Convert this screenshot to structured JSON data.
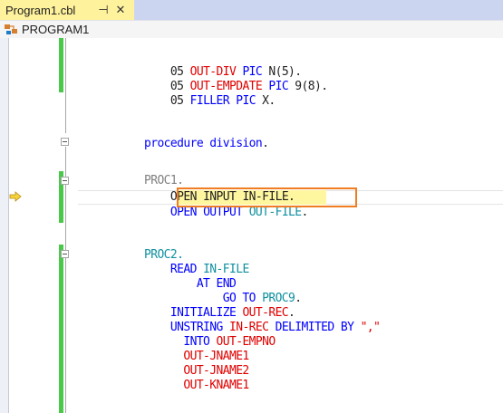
{
  "tab": {
    "title": "Program1.cbl",
    "pin_glyph": "⊣",
    "close_glyph": "✕"
  },
  "nav": {
    "program": "PROGRAM1"
  },
  "colors": {
    "tab_active": "#FFF29D",
    "tabstrip": "#CCD5F0",
    "change_bar": "#49C849",
    "highlight_border": "#F07D22",
    "keyword": "#0000FF",
    "identifier_red": "#E00000"
  },
  "icons": {
    "program": "class-hierarchy-icon",
    "execution": "execution-pointer-arrow-icon"
  },
  "code": [
    {
      "indent": "    ",
      "level": "05",
      "name": "OUT-DIV",
      "pic": "PIC",
      "type": "N(5)."
    },
    {
      "indent": "    ",
      "level": "05",
      "name": "OUT-EMPDATE",
      "pic": "PIC",
      "type": "9(8)."
    },
    {
      "indent": "    ",
      "level": "05",
      "name": "FILLER",
      "pic": "PIC",
      "type": "X."
    },
    {
      "blank": true
    },
    {
      "text": "procedure division."
    },
    {
      "blank": true
    },
    {
      "text": "PROC1."
    },
    {
      "text": "    OPEN INPUT IN-FILE."
    },
    {
      "text": "    OPEN OUTPUT OUT-FILE."
    },
    {
      "blank": true
    },
    {
      "text": "PROC2."
    },
    {
      "text": "    READ IN-FILE"
    },
    {
      "text": "        AT END"
    },
    {
      "text": "            GO TO PROC9."
    },
    {
      "text": "    INITIALIZE OUT-REC."
    },
    {
      "text": "    UNSTRING IN-REC DELIMITED BY \",\""
    },
    {
      "text": "      INTO OUT-EMPNO"
    },
    {
      "text": "      OUT-JNAME1"
    },
    {
      "text": "      OUT-JNAME2"
    },
    {
      "text": "      OUT-KNAME1"
    }
  ],
  "tokens": {
    "l1": [
      "05",
      "OUT-DIV",
      "PIC",
      "N(5)."
    ],
    "l2": [
      "05",
      "OUT-EMPDATE",
      "PIC",
      "9(8)."
    ],
    "l3": [
      "05",
      "FILLER",
      "PIC",
      "X."
    ],
    "proc_div": [
      "procedure",
      "division",
      "."
    ],
    "proc1": "PROC1.",
    "open_input": [
      "OPEN",
      "INPUT",
      "IN-FILE",
      "."
    ],
    "open_output": [
      "OPEN",
      "OUTPUT",
      "OUT-FILE",
      "."
    ],
    "proc2": "PROC2.",
    "read": [
      "READ",
      "IN-FILE"
    ],
    "at_end": "AT END",
    "goto": [
      "GO TO",
      "PROC9",
      "."
    ],
    "initialize": [
      "INITIALIZE",
      "OUT-REC",
      "."
    ],
    "unstring": [
      "UNSTRING",
      "IN-REC",
      "DELIMITED BY",
      "\",\""
    ],
    "into": [
      "INTO",
      "OUT-EMPNO"
    ],
    "jname1": "OUT-JNAME1",
    "jname2": "OUT-JNAME2",
    "kname1": "OUT-KNAME1"
  }
}
